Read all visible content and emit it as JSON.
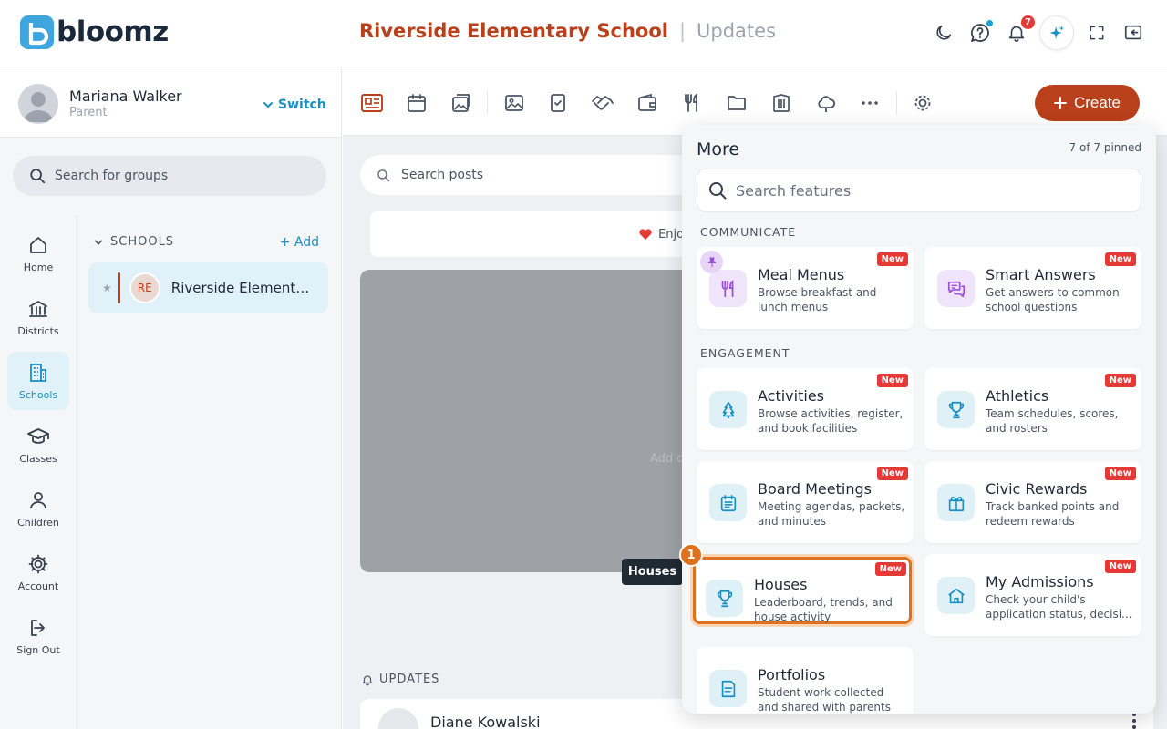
{
  "app": {
    "logo_text": "bloomz"
  },
  "header": {
    "school_name": "Riverside Elementary School",
    "separator": "|",
    "section": "Updates",
    "notification_count": "7"
  },
  "profile": {
    "name": "Mariana Walker",
    "role": "Parent",
    "switch_label": "Switch"
  },
  "group_search": {
    "placeholder": "Search for groups"
  },
  "nav": [
    {
      "label": "Home",
      "icon": "home-icon"
    },
    {
      "label": "Districts",
      "icon": "building-columns-icon"
    },
    {
      "label": "Schools",
      "icon": "school-building-icon"
    },
    {
      "label": "Classes",
      "icon": "graduation-cap-icon"
    },
    {
      "label": "Children",
      "icon": "person-icon"
    },
    {
      "label": "Account",
      "icon": "gear-icon"
    },
    {
      "label": "Sign Out",
      "icon": "sign-out-icon"
    }
  ],
  "groups": {
    "section_label": "SCHOOLS",
    "add_label": "Add",
    "school_initials": "RE",
    "school_label": "Riverside Elementary School"
  },
  "toolbar": {
    "create_label": "Create"
  },
  "posts": {
    "search_placeholder": "Search posts",
    "enjoy_text": "Enjo",
    "media_hint": "Add c",
    "updates_label": "UPDATES",
    "first_author": "Diane Kowalski"
  },
  "tooltip": "Houses",
  "step_number": "1",
  "more": {
    "title": "More",
    "pinned_count": "7 of 7 pinned",
    "search_placeholder": "Search features",
    "new_label": "New",
    "sections": [
      {
        "label": "COMMUNICATE"
      },
      {
        "label": "ENGAGEMENT"
      }
    ],
    "features": [
      {
        "title": "Meal Menus",
        "desc": "Browse breakfast and lunch menus"
      },
      {
        "title": "Smart Answers",
        "desc": "Get answers to common school questions"
      },
      {
        "title": "Activities",
        "desc": "Browse activities, register, and book facilities"
      },
      {
        "title": "Athletics",
        "desc": "Team schedules, scores, and rosters"
      },
      {
        "title": "Board Meetings",
        "desc": "Meeting agendas, packets, and minutes"
      },
      {
        "title": "Civic Rewards",
        "desc": "Track banked points and redeem rewards"
      },
      {
        "title": "Houses",
        "desc": "Leaderboard, trends, and house activity"
      },
      {
        "title": "My Admissions",
        "desc": "Check your child's application status, decisi..."
      },
      {
        "title": "Portfolios",
        "desc": "Student work collected and shared with parents"
      }
    ]
  },
  "colors": {
    "brand": "#b9401b",
    "accent": "#1a8fc2",
    "highlight": "#e0701e",
    "badge": "#e53935"
  }
}
